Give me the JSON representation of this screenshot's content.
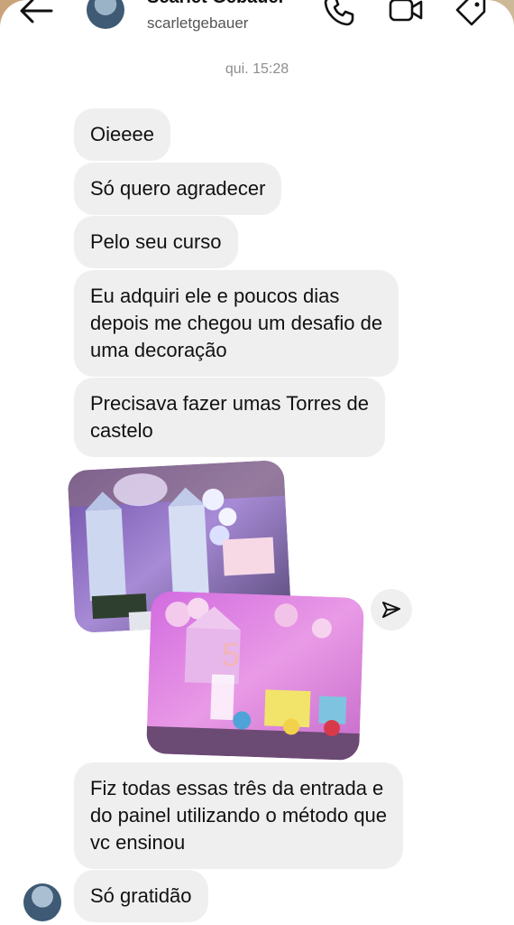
{
  "header": {
    "display_name": "Scarlet Gebauer",
    "username": "scarletgebauer",
    "icons": [
      "back-arrow-icon",
      "phone-icon",
      "video-icon",
      "tag-icon"
    ]
  },
  "timestamp": "qui. 15:28",
  "messages": [
    {
      "lines": [
        "Oieeee"
      ]
    },
    {
      "lines": [
        "Só quero agradecer"
      ]
    },
    {
      "lines": [
        "Pelo seu curso"
      ]
    },
    {
      "lines": [
        "Eu adquiri ele e poucos dias",
        "depois me chegou um desafio de",
        "uma decoração"
      ]
    },
    {
      "lines": [
        "Precisava fazer umas Torres de",
        "castelo"
      ]
    },
    {
      "lines": [
        "Fiz todas essas três da entrada e",
        "do painel utilizando o método que",
        "vc ensinou"
      ]
    },
    {
      "lines": [
        "Só gratidão"
      ]
    }
  ],
  "colors": {
    "bubble": "#efefef",
    "text": "#111111",
    "timestamp": "#8e8e8e"
  }
}
